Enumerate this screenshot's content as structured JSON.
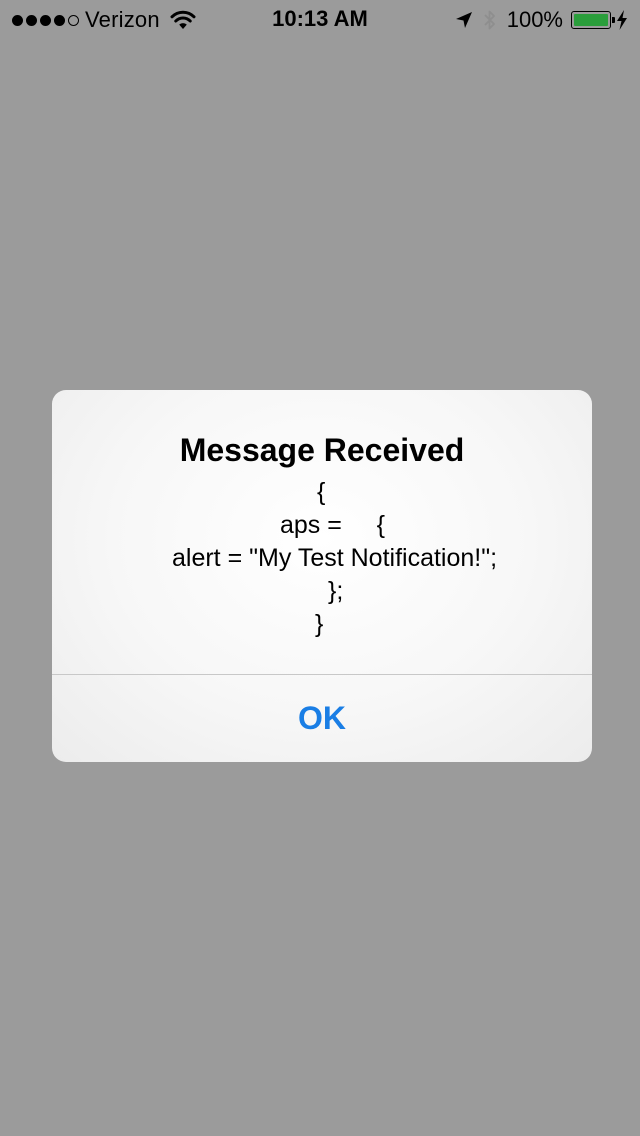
{
  "status_bar": {
    "carrier": "Verizon",
    "signal_bars_filled": 4,
    "signal_bars_total": 5,
    "time": "10:13 AM",
    "battery_percent": "100%",
    "battery_level": 1.0,
    "battery_color": "#2a9e3b",
    "icons": [
      "wifi-icon",
      "location-arrow-icon",
      "bluetooth-icon",
      "charging-bolt-icon"
    ]
  },
  "alert": {
    "title": "Message Received",
    "message_lines": [
      "{",
      "aps =     {",
      "alert = \"My Test Notification!\";",
      "};",
      "}"
    ],
    "ok_label": "OK",
    "ok_color": "#1a7ee5"
  },
  "background_color": "#9b9b9b"
}
